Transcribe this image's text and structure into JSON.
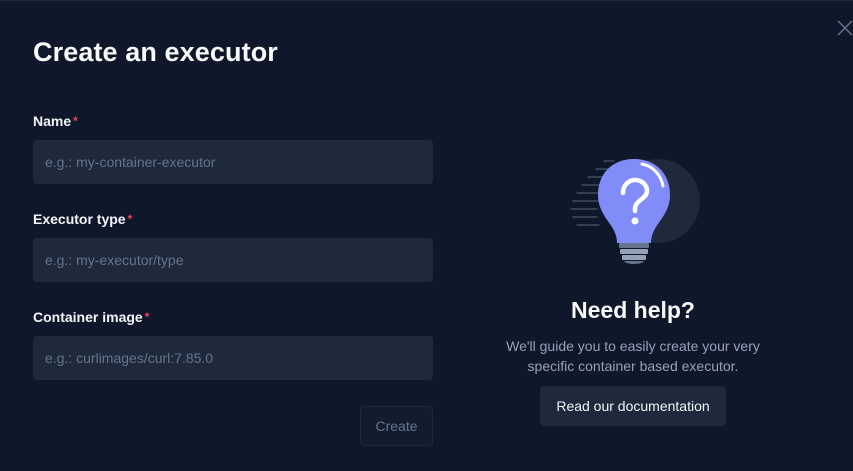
{
  "modal": {
    "title": "Create an executor",
    "close_icon": "close-icon"
  },
  "form": {
    "required_marker": "*",
    "fields": [
      {
        "label": "Name",
        "placeholder": "e.g.: my-container-executor",
        "value": ""
      },
      {
        "label": "Executor type",
        "placeholder": "e.g.: my-executor/type",
        "value": ""
      },
      {
        "label": "Container image",
        "placeholder": "e.g.: curlimages/curl:7.85.0",
        "value": ""
      }
    ],
    "submit_label": "Create",
    "submit_disabled": true
  },
  "help": {
    "icon": "lightbulb-question-icon",
    "title": "Need help?",
    "text": "We'll guide you to easily create your very specific container based executor.",
    "button_label": "Read our documentation"
  },
  "colors": {
    "background": "#0f172a",
    "input_bg": "#1e293b",
    "required": "#f43f5e",
    "accent": "#818cf8"
  }
}
